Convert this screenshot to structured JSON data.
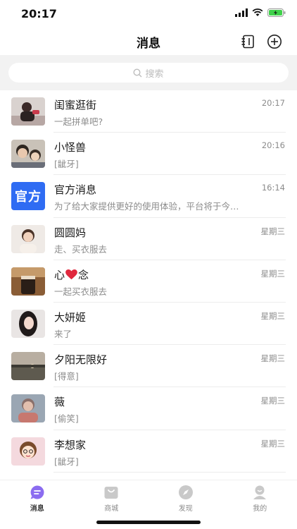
{
  "status": {
    "time": "20:17"
  },
  "header": {
    "title": "消息"
  },
  "search": {
    "placeholder": "搜索"
  },
  "conversations": [
    {
      "name": "闺蜜逛街",
      "preview": "一起拼单吧?",
      "time": "20:17"
    },
    {
      "name": "小怪兽",
      "preview": "[龇牙]",
      "time": "20:16"
    },
    {
      "name": "官方消息",
      "preview": "为了给大家提供更好的使用体验，平台将于今…",
      "time": "16:14",
      "avatar_text": "官方",
      "avatar_color": "#2f6cf3"
    },
    {
      "name": "圆圆妈",
      "preview": "走、买衣服去",
      "time": "星期三"
    },
    {
      "name_pre": "心",
      "name_post": "念",
      "preview": "一起买衣服去",
      "time": "星期三"
    },
    {
      "name": "大妍姬",
      "preview": "来了",
      "time": "星期三"
    },
    {
      "name": "夕阳无限好",
      "preview": "[得意]",
      "time": "星期三"
    },
    {
      "name": "薇",
      "preview": "[偷笑]",
      "time": "星期三"
    },
    {
      "name": "李想家",
      "preview": "[龇牙]",
      "time": "星期三"
    }
  ],
  "tabbar": {
    "items": [
      {
        "label": "消息",
        "active": true
      },
      {
        "label": "商城"
      },
      {
        "label": "发现"
      },
      {
        "label": "我的"
      }
    ],
    "active_color": "#8b6cf0",
    "inactive_color": "#c9c9c9"
  },
  "colors": {
    "accent": "#8b6cf0",
    "official": "#2f6cf3",
    "battery": "#3fd14a"
  }
}
